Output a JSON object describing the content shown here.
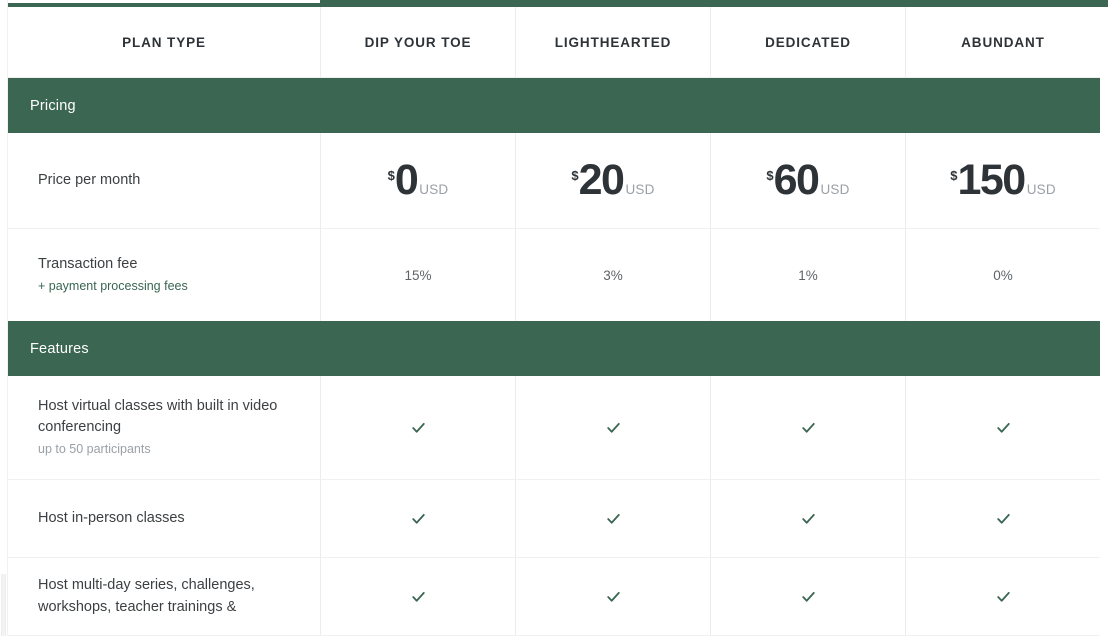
{
  "theme": {
    "accent_green": "#3a6652",
    "text_dark": "#2e3338",
    "text_muted": "#9aa0a6"
  },
  "table": {
    "columns": [
      {
        "key": "label",
        "header": "PLAN TYPE"
      },
      {
        "key": "toe",
        "header": "DIP YOUR TOE"
      },
      {
        "key": "light",
        "header": "LIGHTHEARTED"
      },
      {
        "key": "ded",
        "header": "DEDICATED"
      },
      {
        "key": "abund",
        "header": "ABUNDANT"
      }
    ],
    "sections": [
      {
        "title": "Pricing"
      },
      {
        "title": "Features"
      }
    ],
    "pricing_rows": [
      {
        "label": "Price per month",
        "sublabel": "",
        "values": [
          {
            "currency": "$",
            "amount": "0",
            "unit": "USD"
          },
          {
            "currency": "$",
            "amount": "20",
            "unit": "USD"
          },
          {
            "currency": "$",
            "amount": "60",
            "unit": "USD"
          },
          {
            "currency": "$",
            "amount": "150",
            "unit": "USD"
          }
        ]
      },
      {
        "label": "Transaction fee",
        "sublabel": "+ payment processing fees",
        "values": [
          "15%",
          "3%",
          "1%",
          "0%"
        ]
      }
    ],
    "feature_rows": [
      {
        "label": "Host virtual classes with built in video conferencing",
        "sublabel": "up to 50 participants",
        "values": [
          "check",
          "check",
          "check",
          "check"
        ]
      },
      {
        "label": "Host in-person classes",
        "sublabel": "",
        "values": [
          "check",
          "check",
          "check",
          "check"
        ]
      },
      {
        "label": "Host multi-day series, challenges, workshops, teacher trainings &",
        "sublabel": "",
        "values": [
          "check",
          "check",
          "check",
          "check"
        ]
      }
    ],
    "check_icon": "check-icon"
  }
}
